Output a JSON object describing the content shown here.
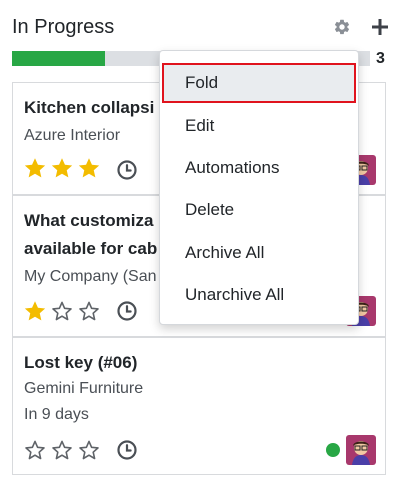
{
  "column": {
    "title": "In Progress",
    "count": "3",
    "progress_fraction": 0.26
  },
  "colors": {
    "progress_green": "#28a745",
    "star_gold": "#f3bc00",
    "star_empty_stroke": "#5f6368",
    "status_green": "#28a745",
    "menu_highlight_border": "#e0131d"
  },
  "icons": {
    "settings": "gear-icon",
    "add": "plus-icon",
    "activity": "clock-icon",
    "rating_filled": "star-filled-icon",
    "rating_empty": "star-empty-icon"
  },
  "cards": [
    {
      "title": "Kitchen collapsi",
      "customer": "Azure Interior",
      "stars": 3
    },
    {
      "title_line1": "What customiza",
      "title_line2": "available for cab",
      "customer": "My Company (San",
      "stars": 1
    },
    {
      "title": "Lost key (#06)",
      "customer": "Gemini Furniture",
      "deadline": "In 9 days",
      "stars": 0
    }
  ],
  "menu": {
    "items": [
      {
        "label": "Fold"
      },
      {
        "label": "Edit"
      },
      {
        "label": "Automations"
      },
      {
        "label": "Delete"
      },
      {
        "label": "Archive All"
      },
      {
        "label": "Unarchive All"
      }
    ]
  }
}
